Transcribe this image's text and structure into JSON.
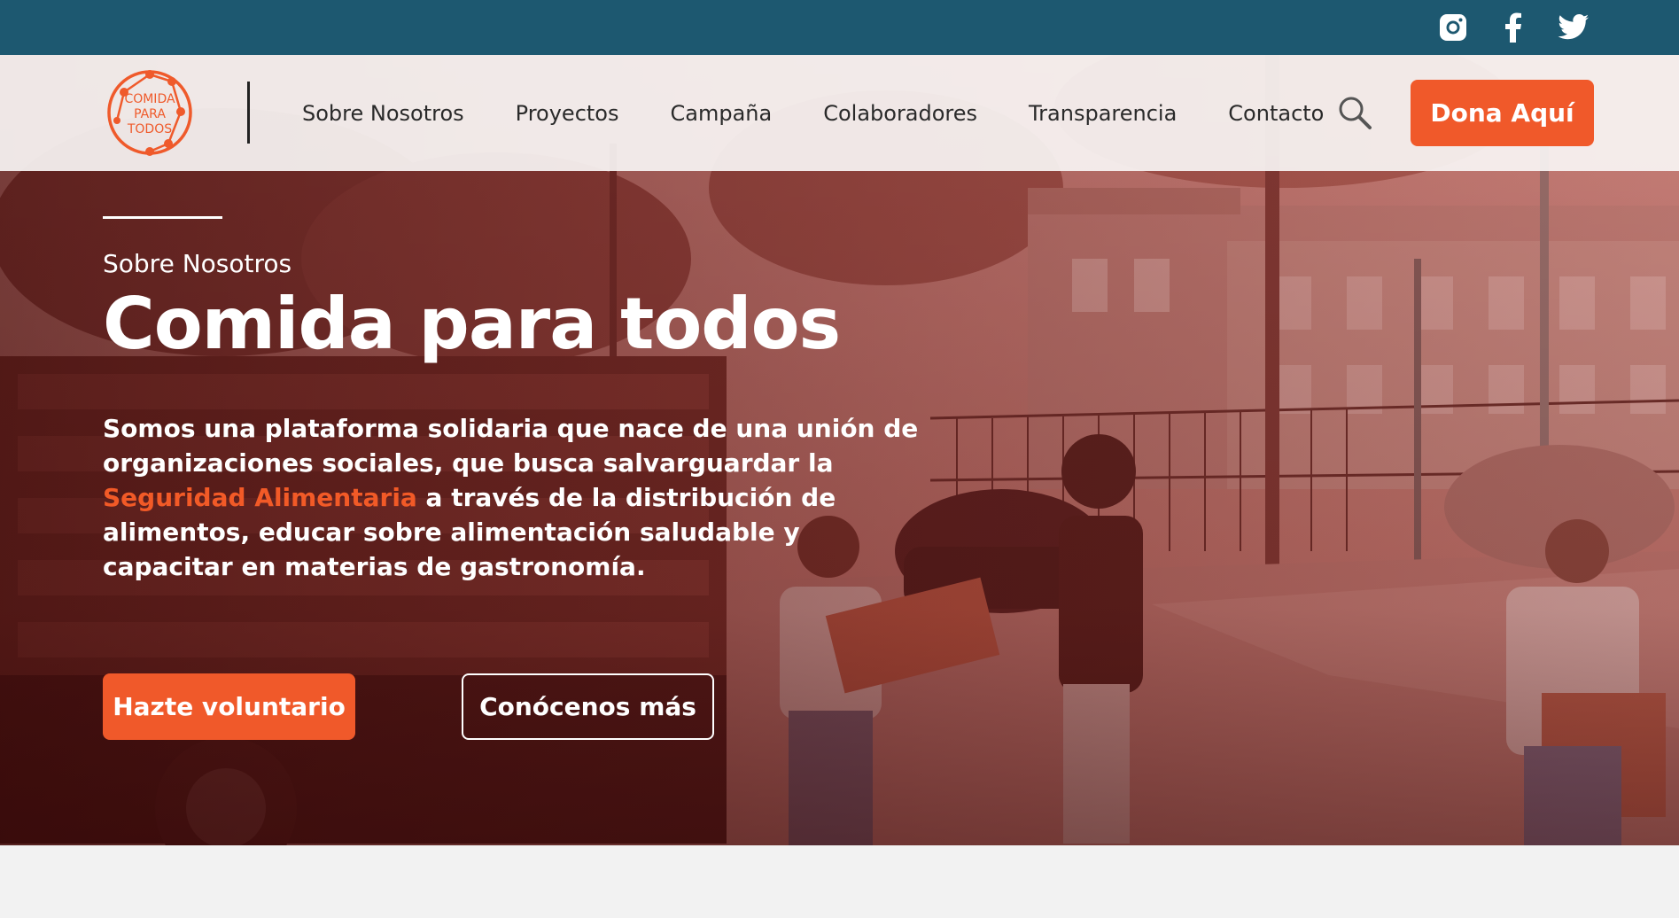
{
  "social": {
    "icons": [
      "instagram-icon",
      "facebook-icon",
      "twitter-icon"
    ]
  },
  "logo": {
    "line1": "COMIDA",
    "line2": "PARA",
    "line3": "TODOS"
  },
  "nav": {
    "items": [
      "Sobre Nosotros",
      "Proyectos",
      "Campaña",
      "Colaboradores",
      "Transparencia",
      "Contacto"
    ],
    "donate_label": "Dona Aquí"
  },
  "hero": {
    "eyebrow": "Sobre Nosotros",
    "title": "Comida para todos",
    "desc_part1": "Somos una plataforma solidaria que nace de una unión de organizaciones sociales, que busca salvarguardar la ",
    "desc_highlight": "Seguridad Alimentaria",
    "desc_part2": " a través de la distribución de alimentos, educar sobre alimentación saludable y capacitar en materias de gastronomía.",
    "btn_primary": "Hazte voluntario",
    "btn_secondary": "Conócenos más"
  },
  "colors": {
    "topbar": "#1d5870",
    "accent": "#f0592a",
    "overlay": "#b84b45"
  }
}
